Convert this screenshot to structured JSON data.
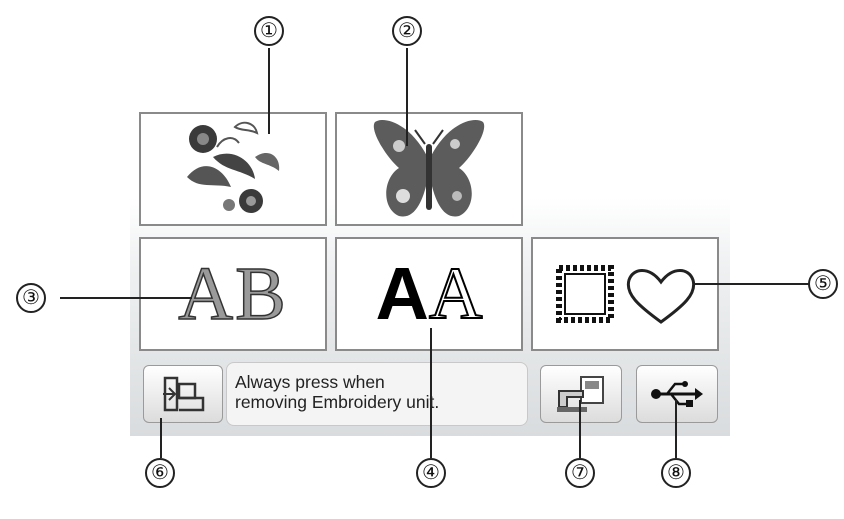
{
  "callouts": {
    "c1": "①",
    "c2": "②",
    "c3": "③",
    "c4": "④",
    "c5": "⑤",
    "c6": "⑥",
    "c7": "⑦",
    "c8": "⑧"
  },
  "tiles": {
    "ab_text": "AB",
    "aa_bold": "A",
    "aa_outline": "A"
  },
  "message": "Always press when\nremoving Embroidery unit.",
  "icons": {
    "floral": "floral-pattern-icon",
    "butterfly": "butterfly-pattern-icon",
    "frame": "frame-heart-icon",
    "release": "embroidery-unit-release-icon",
    "machine": "machine-connect-icon",
    "usb": "usb-icon"
  }
}
